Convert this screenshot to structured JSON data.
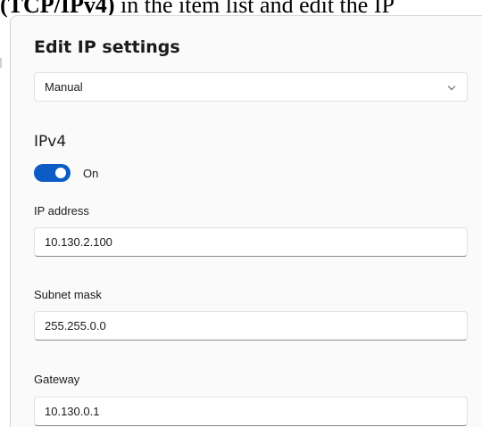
{
  "doc_fragment": {
    "bold_text": "(TCP/IPv4)",
    "plain_text": " in the item list and edit the IP"
  },
  "dialog": {
    "title": "Edit IP settings",
    "mode_select": {
      "value": "Manual"
    },
    "ipv4": {
      "heading": "IPv4",
      "toggle_label": "On",
      "toggle_on": true,
      "fields": {
        "ip_address": {
          "label": "IP address",
          "value": "10.130.2.100"
        },
        "subnet_mask": {
          "label": "Subnet mask",
          "value": "255.255.0.0"
        },
        "gateway": {
          "label": "Gateway",
          "value": "10.130.0.1"
        }
      }
    }
  },
  "colors": {
    "accent": "#0b5cc4",
    "dialog_background": "#fafafa",
    "field_border": "#e2e2e2"
  },
  "icons": {
    "dropdown": "chevron-down-icon"
  }
}
